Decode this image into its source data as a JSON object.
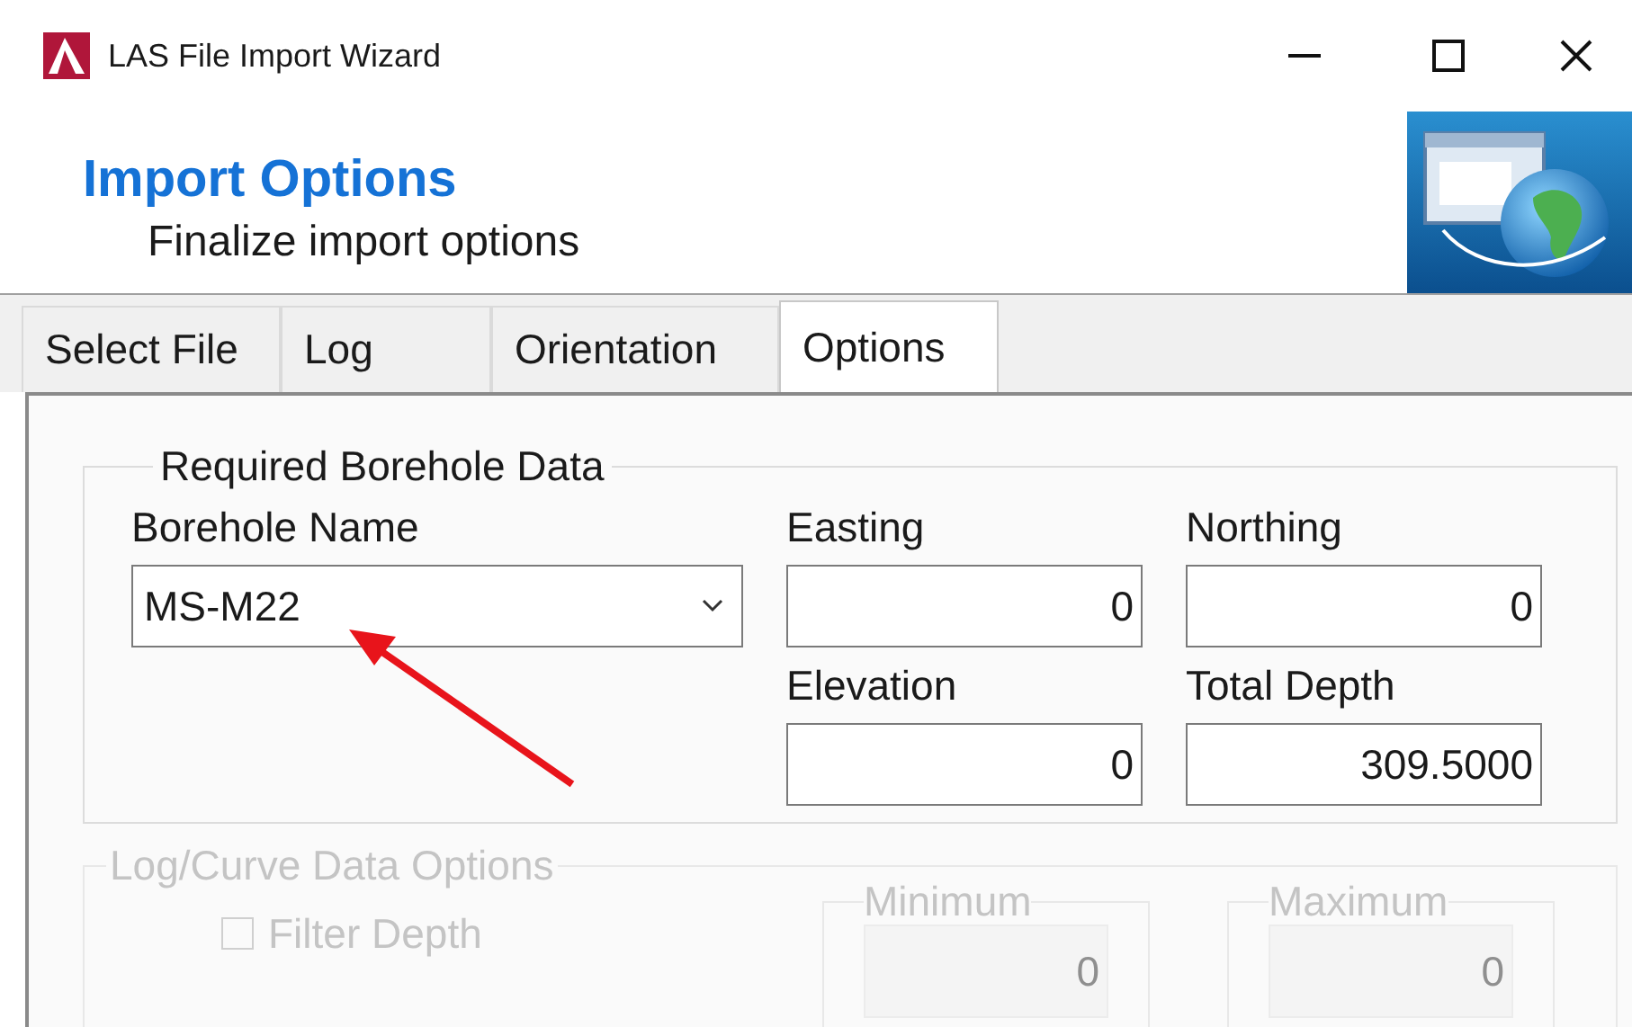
{
  "window": {
    "title": "LAS File Import Wizard"
  },
  "header": {
    "title": "Import Options",
    "subtitle": "Finalize import options"
  },
  "tabs": [
    {
      "label": "Select File",
      "selected": false
    },
    {
      "label": "Log",
      "selected": false
    },
    {
      "label": "Orientation",
      "selected": false
    },
    {
      "label": "Options",
      "selected": true
    }
  ],
  "required_group": {
    "title": "Required Borehole Data",
    "fields": [
      {
        "kind": "combo",
        "label": "Borehole Name",
        "value": "MS-M22"
      },
      {
        "kind": "text",
        "label": "Easting",
        "value": "0"
      },
      {
        "kind": "text",
        "label": "Northing",
        "value": "0"
      },
      {
        "kind": "text",
        "label": "Elevation",
        "value": "0"
      },
      {
        "kind": "text",
        "label": "Total Depth",
        "value": "309.5000"
      }
    ]
  },
  "log_curve_group": {
    "title": "Log/Curve Data Options",
    "disabled": true,
    "filter_depth": {
      "label": "Filter Depth",
      "checked": false
    },
    "ranges": [
      {
        "label": "Minimum",
        "value": "0"
      },
      {
        "label": "Maximum",
        "value": "0"
      }
    ]
  }
}
